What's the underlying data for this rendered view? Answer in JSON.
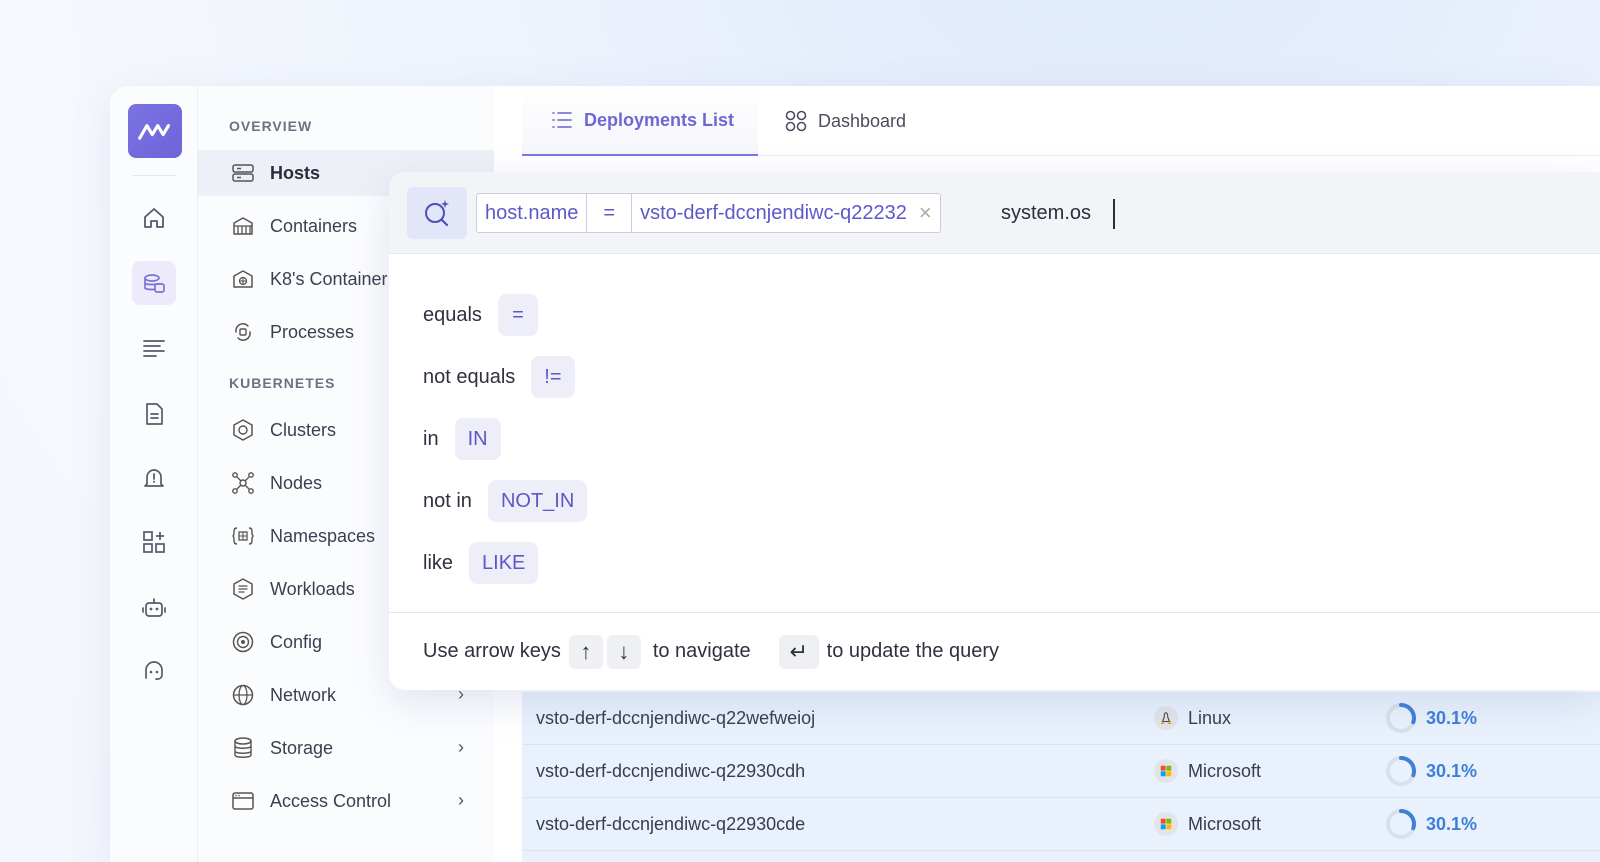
{
  "rail": {
    "icons": [
      "home-icon",
      "hosts-icon",
      "logs-icon",
      "document-icon",
      "alert-icon",
      "dashboard-add-icon",
      "robot-icon",
      "support-icon"
    ],
    "active_index": 1
  },
  "nav": {
    "section_overview": "OVERVIEW",
    "section_kubernetes": "KUBERNETES",
    "items": [
      {
        "label": "Hosts"
      },
      {
        "label": "Containers"
      },
      {
        "label": "K8's Container"
      },
      {
        "label": "Processes"
      },
      {
        "label": "Clusters"
      },
      {
        "label": "Nodes"
      },
      {
        "label": "Namespaces"
      },
      {
        "label": "Workloads"
      },
      {
        "label": "Config"
      },
      {
        "label": "Network",
        "chevron": "›"
      },
      {
        "label": "Storage",
        "chevron": "›"
      },
      {
        "label": "Access Control",
        "chevron": "›"
      }
    ]
  },
  "tabs": {
    "deployments": "Deployments List",
    "dashboard": "Dashboard"
  },
  "query": {
    "field": "host.name",
    "operator": "=",
    "value": "vsto-derf-dccnjendiwc-q22232",
    "clear": "×",
    "input_value": "system.os"
  },
  "operators": [
    {
      "label": "equals",
      "token": "="
    },
    {
      "label": "not equals",
      "token": "!="
    },
    {
      "label": "in",
      "token": "IN"
    },
    {
      "label": "not in",
      "token": "NOT_IN"
    },
    {
      "label": "like",
      "token": "LIKE"
    }
  ],
  "footer": {
    "prefix": "Use arrow keys",
    "up": "↑",
    "down": "↓",
    "middle": "to navigate",
    "enter": "↵",
    "suffix": "to update the query"
  },
  "rows": [
    {
      "name": "vsto-derf-dccnjendiwc-q22wefweioj",
      "os": "Linux",
      "os_icon": "linux-icon",
      "pct": "30.1%",
      "pct_value": 0.301
    },
    {
      "name": "vsto-derf-dccnjendiwc-q22930cdh",
      "os": "Microsoft",
      "os_icon": "microsoft-icon",
      "pct": "30.1%",
      "pct_value": 0.301
    },
    {
      "name": "vsto-derf-dccnjendiwc-q22930cde",
      "os": "Microsoft",
      "os_icon": "microsoft-icon",
      "pct": "30.1%",
      "pct_value": 0.301
    }
  ],
  "colors": {
    "accent": "#6f68d4",
    "progress": "#3f7fd8",
    "table_bg": "#e9f1fc"
  }
}
